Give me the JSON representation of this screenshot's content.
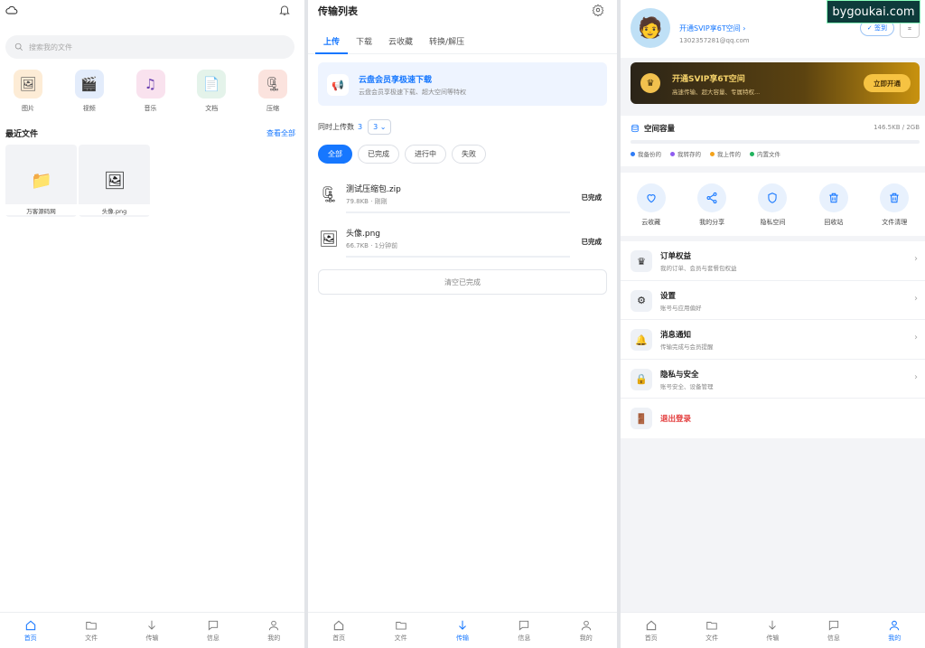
{
  "watermark": "bygoukai.com",
  "home": {
    "search_placeholder": "搜索我的文件",
    "categories": [
      {
        "label": "图片",
        "icon": "image-icon",
        "bg": "#fdecd6"
      },
      {
        "label": "视频",
        "icon": "video-icon",
        "bg": "#e3ecfb"
      },
      {
        "label": "音乐",
        "icon": "music-icon",
        "bg": "#f9e2ee"
      },
      {
        "label": "文档",
        "icon": "document-icon",
        "bg": "#e4f3ea"
      },
      {
        "label": "压缩",
        "icon": "zip-icon",
        "bg": "#fbe3de"
      }
    ],
    "recent_title": "最近文件",
    "see_all": "查看全部",
    "files": [
      {
        "name": "万客源码网",
        "icon": "folder-icon"
      },
      {
        "name": "头像.png",
        "icon": "image-file-icon"
      }
    ]
  },
  "transfer": {
    "title": "传输列表",
    "tabs": [
      "上传",
      "下载",
      "云收藏",
      "转换/解压"
    ],
    "active_tab": 0,
    "promo_title": "云盘会员享极速下载",
    "promo_sub": "云盘会员享极速下载、超大空间等特权",
    "concurrent_label": "同时上传数",
    "concurrent_value": "3",
    "concurrent_select": "3",
    "filters": [
      "全部",
      "已完成",
      "进行中",
      "失败"
    ],
    "items": [
      {
        "name": "测试压缩包.zip",
        "meta": "79.8KB · 刚刚",
        "status": "已完成",
        "icon": "zip-file-icon"
      },
      {
        "name": "头像.png",
        "meta": "66.7KB · 1分钟前",
        "status": "已完成",
        "icon": "image-file-icon"
      }
    ],
    "clear_label": "清空已完成"
  },
  "profile": {
    "vip_link": "开通SVIP享6T空间 ›",
    "email": "1302357281@qq.com",
    "sign_label": "✓ 签到",
    "scan_label": "⌗",
    "vip_card": {
      "title": "开通SVIP享6T空间",
      "sub": "高速传输、超大容量、专属特权...",
      "button": "立即开通"
    },
    "storage": {
      "title": "空间容量",
      "value": "146.5KB / 2GB",
      "legend": [
        {
          "label": "我备份的",
          "color": "#2f7cf6"
        },
        {
          "label": "我转存的",
          "color": "#8e5cf0"
        },
        {
          "label": "我上传的",
          "color": "#f3a21a"
        },
        {
          "label": "内置文件",
          "color": "#22b35e"
        }
      ]
    },
    "quick": [
      {
        "label": "云收藏",
        "icon": "heart-icon"
      },
      {
        "label": "我的分享",
        "icon": "share-icon"
      },
      {
        "label": "隐私空间",
        "icon": "shield-icon"
      },
      {
        "label": "回收站",
        "icon": "trash-icon"
      },
      {
        "label": "文件清理",
        "icon": "clean-icon"
      }
    ],
    "menu": [
      {
        "title": "订单权益",
        "sub": "我的订单、会员与套餐包权益",
        "icon": "crown-icon"
      },
      {
        "title": "设置",
        "sub": "账号与应用偏好",
        "icon": "settings-icon"
      },
      {
        "title": "消息通知",
        "sub": "传输完成与会员提醒",
        "icon": "bell-icon"
      },
      {
        "title": "隐私与安全",
        "sub": "账号安全、设备管理",
        "icon": "lock-icon"
      }
    ],
    "logout": "退出登录"
  },
  "nav": [
    "首页",
    "文件",
    "传输",
    "信息",
    "我的"
  ]
}
